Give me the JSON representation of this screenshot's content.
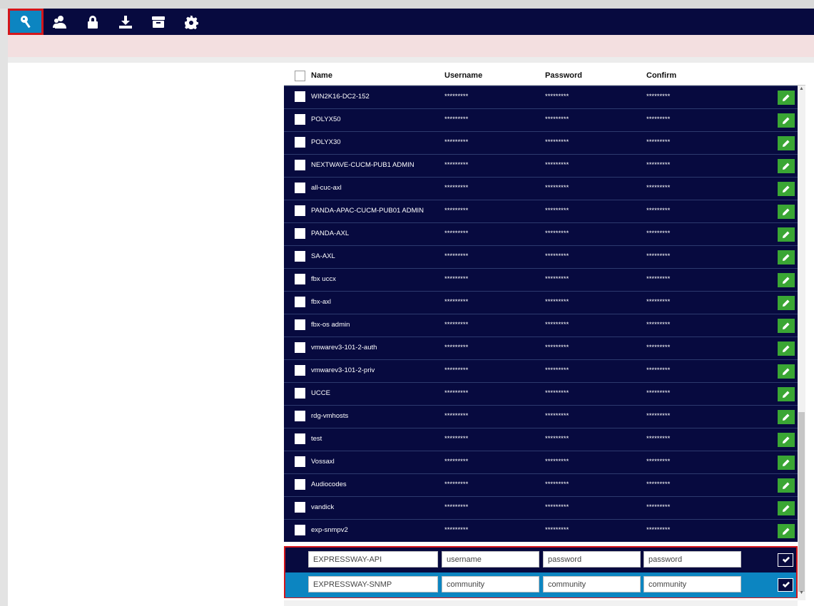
{
  "toolbar": {
    "buttons": [
      {
        "icon": "key-icon",
        "active": true
      },
      {
        "icon": "users-icon"
      },
      {
        "icon": "lock-icon"
      },
      {
        "icon": "download-icon"
      },
      {
        "icon": "archive-icon"
      },
      {
        "icon": "gear-icon"
      }
    ]
  },
  "grid": {
    "headers": {
      "name": "Name",
      "username": "Username",
      "password": "Password",
      "confirm": "Confirm"
    },
    "masked": "*********",
    "rows": [
      {
        "name": "WIN2K16-DC2-152"
      },
      {
        "name": "POLYX50"
      },
      {
        "name": "POLYX30"
      },
      {
        "name": "NEXTWAVE-CUCM-PUB1 ADMIN"
      },
      {
        "name": "all-cuc-axl"
      },
      {
        "name": "PANDA-APAC-CUCM-PUB01 ADMIN"
      },
      {
        "name": "PANDA-AXL"
      },
      {
        "name": "SA-AXL"
      },
      {
        "name": "fbx uccx"
      },
      {
        "name": "fbx-axl"
      },
      {
        "name": "fbx-os admin"
      },
      {
        "name": "vmwarev3-101-2-auth"
      },
      {
        "name": "vmwarev3-101-2-priv"
      },
      {
        "name": "UCCE"
      },
      {
        "name": "rdg-vmhosts"
      },
      {
        "name": "test"
      },
      {
        "name": "Vossaxl"
      },
      {
        "name": "Audiocodes"
      },
      {
        "name": "vandick"
      },
      {
        "name": "exp-snmpv2"
      }
    ],
    "new_rows": [
      {
        "name": "EXPRESSWAY-API",
        "username": "username",
        "password": "password",
        "confirm": "password"
      },
      {
        "name": "EXPRESSWAY-SNMP",
        "username": "community",
        "password": "community",
        "confirm": "community"
      }
    ]
  },
  "colors": {
    "navy": "#070a3f",
    "blue": "#0c85c1",
    "green": "#3aa634",
    "highlight": "#d4161b"
  }
}
